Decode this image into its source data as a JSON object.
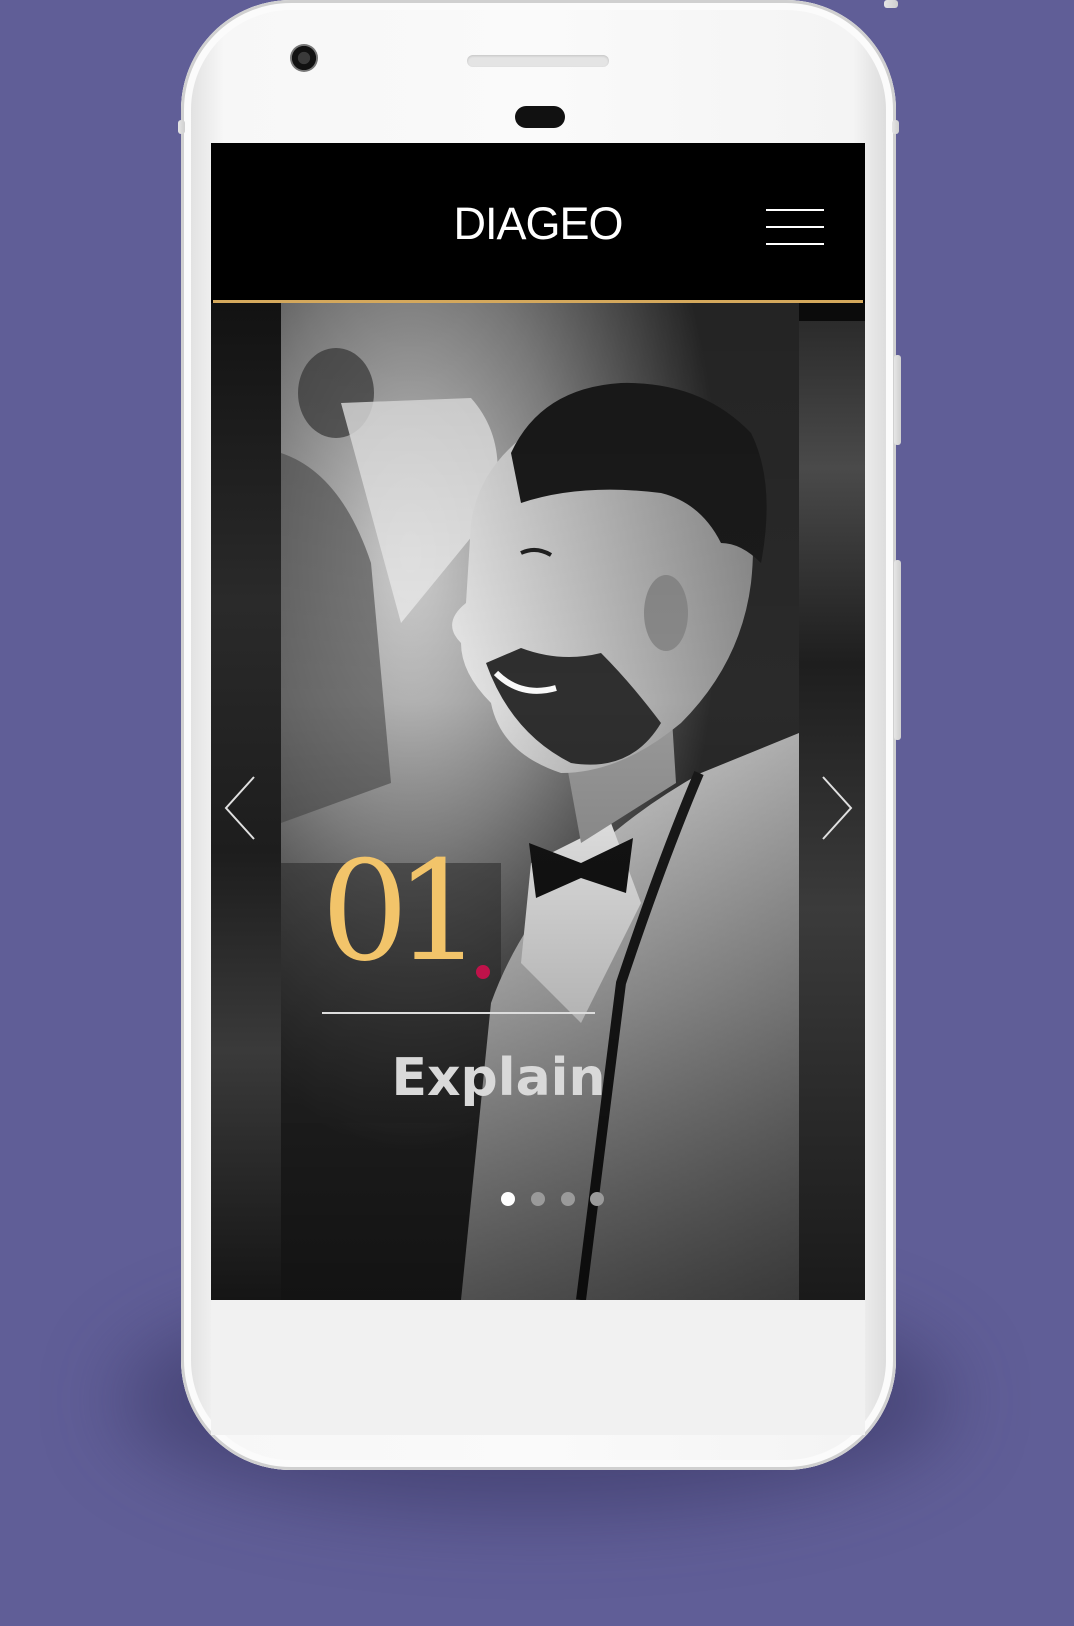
{
  "app": {
    "brand": "DIAGEO"
  },
  "header": {
    "menu_icon": "hamburger-menu-icon",
    "rule_color": "#d4a85c"
  },
  "carousel": {
    "current_slide": 1,
    "total_slides": 4,
    "slide": {
      "number": "01",
      "title": "Explain",
      "number_color": "#f2c46a",
      "accent_dot_color": "#c0124a",
      "image": "black-and-white photo of smiling bearded man in white dinner jacket with bow tie"
    },
    "prev_icon": "chevron-left-icon",
    "next_icon": "chevron-right-icon"
  },
  "colors": {
    "background": "#605e97",
    "screen": "#000000",
    "pagination_active": "#ffffff",
    "pagination_inactive": "#9a9a9a"
  }
}
